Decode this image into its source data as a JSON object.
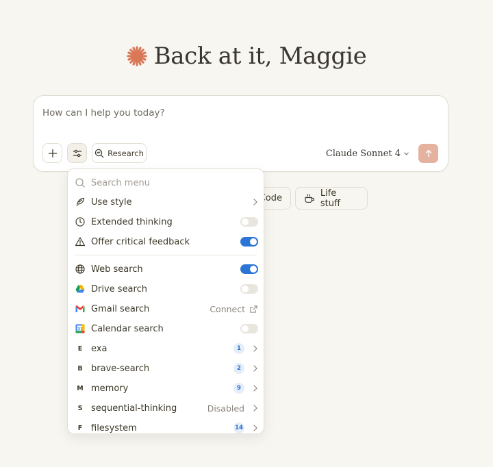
{
  "greeting": {
    "text": "Back at it, Maggie",
    "accent": "#d97757"
  },
  "chat": {
    "placeholder": "How can I help you today?",
    "research_label": "Research",
    "model_label": "Claude Sonnet 4",
    "send_color": "#e6b2a0"
  },
  "chips": {
    "code_label": "Code",
    "life_label": "Life stuff"
  },
  "menu": {
    "search_placeholder": "Search menu",
    "items": [
      {
        "label": "Use style",
        "icon": "feather-icon",
        "right": "chevron"
      },
      {
        "label": "Extended thinking",
        "icon": "clock-icon",
        "right": "toggle",
        "on": false
      },
      {
        "label": "Offer critical feedback",
        "icon": "warning-icon",
        "right": "toggle",
        "on": true
      },
      {
        "label": "Web search",
        "icon": "globe-icon",
        "right": "toggle",
        "on": true
      },
      {
        "label": "Drive search",
        "icon": "google-drive-icon",
        "right": "toggle",
        "on": false
      },
      {
        "label": "Gmail search",
        "icon": "gmail-icon",
        "right": "connect",
        "trail": "Connect"
      },
      {
        "label": "Calendar search",
        "icon": "google-calendar-icon",
        "right": "toggle",
        "on": false
      },
      {
        "label": "exa",
        "letter": "E",
        "count": "1",
        "right": "count"
      },
      {
        "label": "brave-search",
        "letter": "B",
        "count": "2",
        "right": "count"
      },
      {
        "label": "memory",
        "letter": "M",
        "count": "9",
        "right": "count"
      },
      {
        "label": "sequential-thinking",
        "letter": "S",
        "trail": "Disabled",
        "right": "disabled"
      },
      {
        "label": "filesystem",
        "letter": "F",
        "count": "14",
        "right": "count"
      }
    ]
  },
  "colors": {
    "toggle_on": "#2c74d6",
    "toggle_off": "#e9e6de",
    "badge_bg": "#e4eefb",
    "badge_text": "#2c6fc9"
  }
}
